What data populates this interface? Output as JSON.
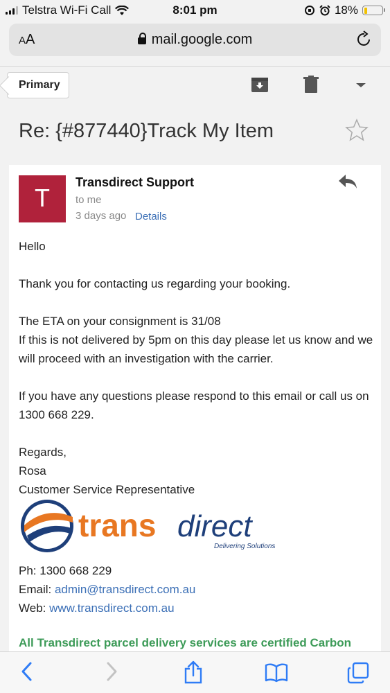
{
  "status": {
    "carrier": "Telstra Wi-Fi Call",
    "time": "8:01 pm",
    "battery": "18%",
    "battery_level": 0.18
  },
  "browser": {
    "text_size_label": "AA",
    "url": "mail.google.com"
  },
  "toolbar": {
    "label_button": "Primary"
  },
  "email": {
    "subject": "Re: {#877440}Track My Item",
    "sender_initial": "T",
    "sender": "Transdirect Support",
    "to": "to me",
    "time": "3 days ago",
    "details_link": "Details",
    "greeting": "Hello",
    "para1": "Thank you for contacting us regarding your booking.",
    "para2_line1": "The ETA on your consignment is 31/08",
    "para2_line2": "If this is not delivered by 5pm on this day please let us know and we will proceed with an investigation with the carrier.",
    "para3": "If you have any questions please respond to this email or call us on 1300 668 229.",
    "regards": "Regards,",
    "signer": "Rosa",
    "role": "Customer Service Representative",
    "logo_text_trans": "trans",
    "logo_text_direct": "direct",
    "logo_tagline": "Delivering Solutions",
    "phone_label": "Ph: ",
    "phone": "1300 668 229",
    "email_label": "Email: ",
    "email": "admin@transdirect.com.au",
    "web_label": "Web: ",
    "web": "www.transdirect.com.au",
    "cert_text": "All Transdirect parcel delivery services are certified Carbon"
  }
}
